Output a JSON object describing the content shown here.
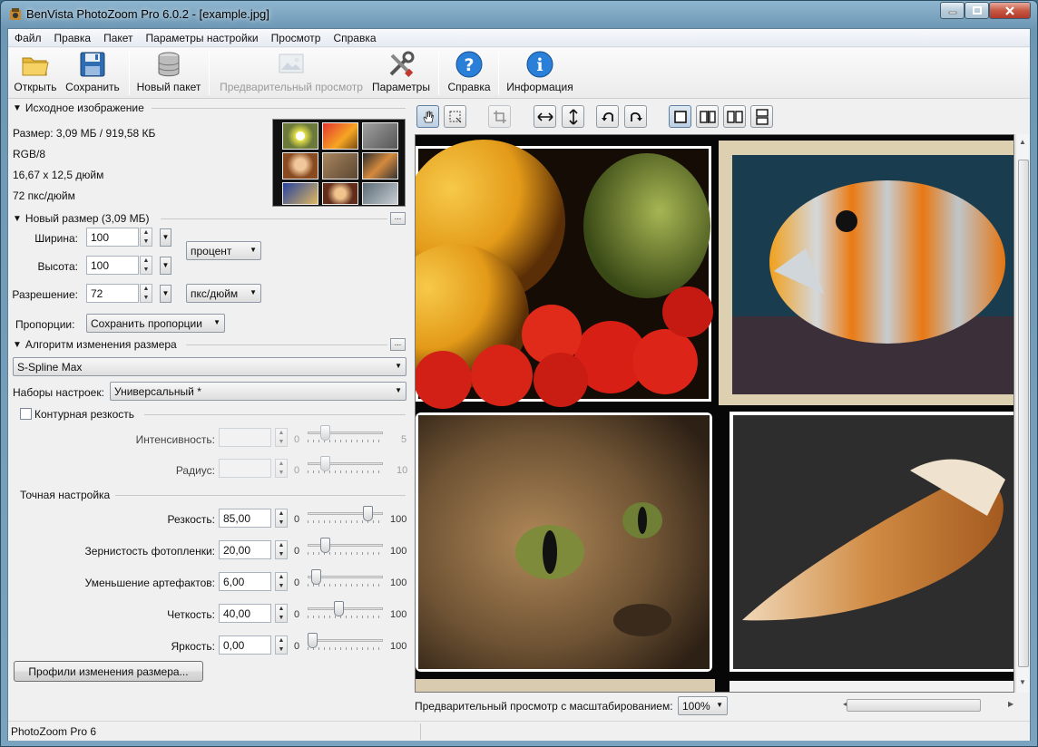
{
  "window": {
    "title": "BenVista PhotoZoom Pro 6.0.2 - [example.jpg]"
  },
  "menu": [
    "Файл",
    "Правка",
    "Пакет",
    "Параметры настройки",
    "Просмотр",
    "Справка"
  ],
  "toolbar": {
    "open": "Открыть",
    "save": "Сохранить",
    "new_batch": "Новый пакет",
    "preview": "Предварительный просмотр",
    "settings": "Параметры",
    "help": "Справка",
    "info": "Информация"
  },
  "source": {
    "header": "Исходное изображение",
    "size": "Размер: 3,09 МБ / 919,58 КБ",
    "mode": "RGB/8",
    "dimensions": "16,67 x 12,5 дюйм",
    "resolution": "72 пкс/дюйм"
  },
  "newsize": {
    "header": "Новый размер (3,09 МБ)",
    "width_label": "Ширина:",
    "width": "100",
    "height_label": "Высота:",
    "height": "100",
    "res_label": "Разрешение:",
    "res": "72",
    "unit": "процент",
    "res_unit": "пкс/дюйм",
    "prop_label": "Пропорции:",
    "prop": "Сохранить пропорции",
    "more": "..."
  },
  "algo": {
    "header": "Алгоритм изменения размера",
    "method": "S-Spline Max",
    "presets_label": "Наборы настроек:",
    "presets": "Универсальный *",
    "more": "..."
  },
  "contour": {
    "label": "Контурная резкость",
    "intensity_label": "Интенсивность:",
    "intensity_min": "0",
    "intensity_max": "5",
    "intensity_level": 0.2,
    "radius_label": "Радиус:",
    "radius_min": "0",
    "radius_max": "10",
    "radius_level": 0.2
  },
  "fine": {
    "header": "Точная настройка",
    "rows": [
      {
        "label": "Резкость:",
        "value": "85,00",
        "min": "0",
        "max": "100",
        "level": 0.85
      },
      {
        "label": "Зернистость фотопленки:",
        "value": "20,00",
        "min": "0",
        "max": "100",
        "level": 0.2
      },
      {
        "label": "Уменьшение артефактов:",
        "value": "6,00",
        "min": "0",
        "max": "100",
        "level": 0.06
      },
      {
        "label": "Четкость:",
        "value": "40,00",
        "min": "0",
        "max": "100",
        "level": 0.4
      },
      {
        "label": "Яркость:",
        "value": "0,00",
        "min": "0",
        "max": "100",
        "level": 0.0
      }
    ]
  },
  "profiles_button": "Профили изменения размера...",
  "zoom": {
    "label": "Предварительный просмотр с масштабированием:",
    "value": "100%"
  },
  "status": "PhotoZoom Pro 6"
}
